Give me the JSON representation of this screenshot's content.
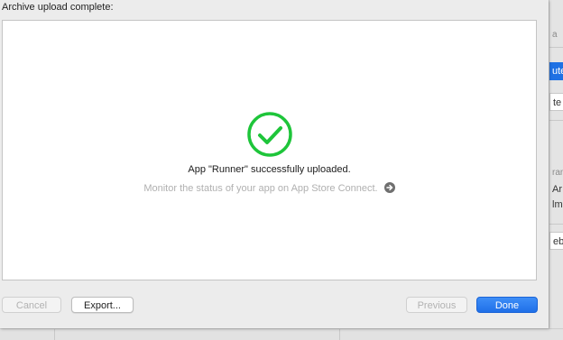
{
  "sheet": {
    "title": "Archive upload complete:",
    "message": "App \"Runner\" successfully uploaded.",
    "submessage": "Monitor the status of your app on App Store Connect.",
    "success_icon": "checkmark-circle-icon",
    "link_icon": "arrow-right-circle-icon",
    "success_color": "#1ec53a"
  },
  "buttons": {
    "cancel": "Cancel",
    "export": "Export...",
    "previous": "Previous",
    "done": "Done"
  },
  "background_window": {
    "fragments": [
      "a",
      "ute",
      "te",
      "ran",
      "Ar",
      "lm",
      "ebu"
    ]
  },
  "colors": {
    "accent": "#1f71e4"
  }
}
